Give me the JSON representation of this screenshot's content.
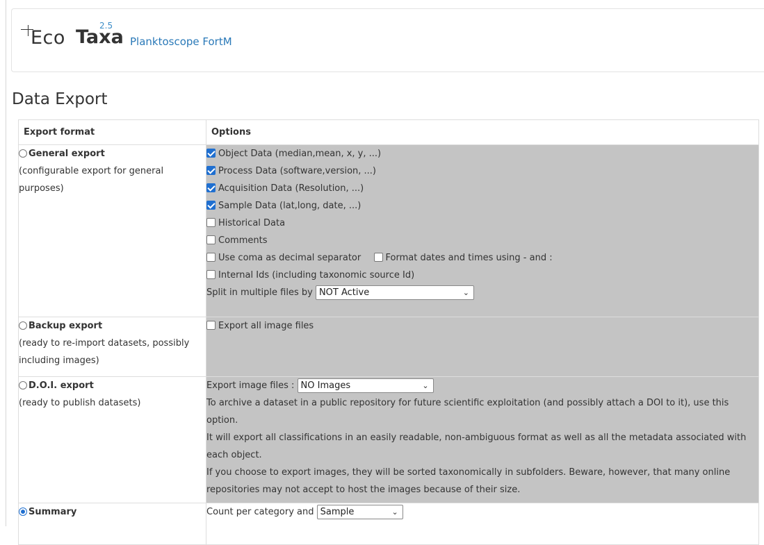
{
  "header": {
    "logo_eco": "Eco",
    "logo_taxa": "Taxa",
    "version": "2.5",
    "project_name": "Planktoscope FortM"
  },
  "page_title": "Data Export",
  "table": {
    "col_format": "Export format",
    "col_options": "Options"
  },
  "general": {
    "radio_label": "General export",
    "description": "(configurable export for general purposes)",
    "selected": false,
    "options": [
      {
        "label": "Object Data (median,mean, x, y, ...)",
        "checked": true
      },
      {
        "label": "Process Data (software,version, ...)",
        "checked": true
      },
      {
        "label": "Acquisition Data (Resolution, ...)",
        "checked": true
      },
      {
        "label": "Sample Data (lat,long, date, ...)",
        "checked": true
      },
      {
        "label": "Historical Data",
        "checked": false
      },
      {
        "label": "Comments",
        "checked": false
      }
    ],
    "coma_label": "Use coma as decimal separator",
    "coma_checked": false,
    "dates_label": "Format dates and times using - and :",
    "dates_checked": false,
    "internal_ids_label": "Internal Ids (including taxonomic source Id)",
    "internal_ids_checked": false,
    "split_label": "Split in multiple files by",
    "split_value": "NOT Active"
  },
  "backup": {
    "radio_label": "Backup export",
    "description": "(ready to re-import datasets, possibly including images)",
    "selected": false,
    "images_label": "Export all image files",
    "images_checked": false
  },
  "doi": {
    "radio_label": "D.O.I. export",
    "description": "(ready to publish datasets)",
    "selected": false,
    "images_label": "Export image files :",
    "images_value": "NO Images",
    "para1": "To archive a dataset in a public repository for future scientific exploitation (and possibly attach a DOI to it), use this option.",
    "para2": "It will export all classifications in an easily readable, non-ambiguous format as well as all the metadata associated with each object.",
    "para3": "If you choose to export images, they will be sorted taxonomically in subfolders. Beware, however, that many online repositories may not accept to host the images because of their size."
  },
  "summary": {
    "radio_label": "Summary",
    "selected": true,
    "count_label": "Count per category and",
    "count_value": "Sample"
  },
  "colors": {
    "accent": "#1f6fd0",
    "link": "#2a79b8",
    "options_bg": "#c4c4c4"
  }
}
